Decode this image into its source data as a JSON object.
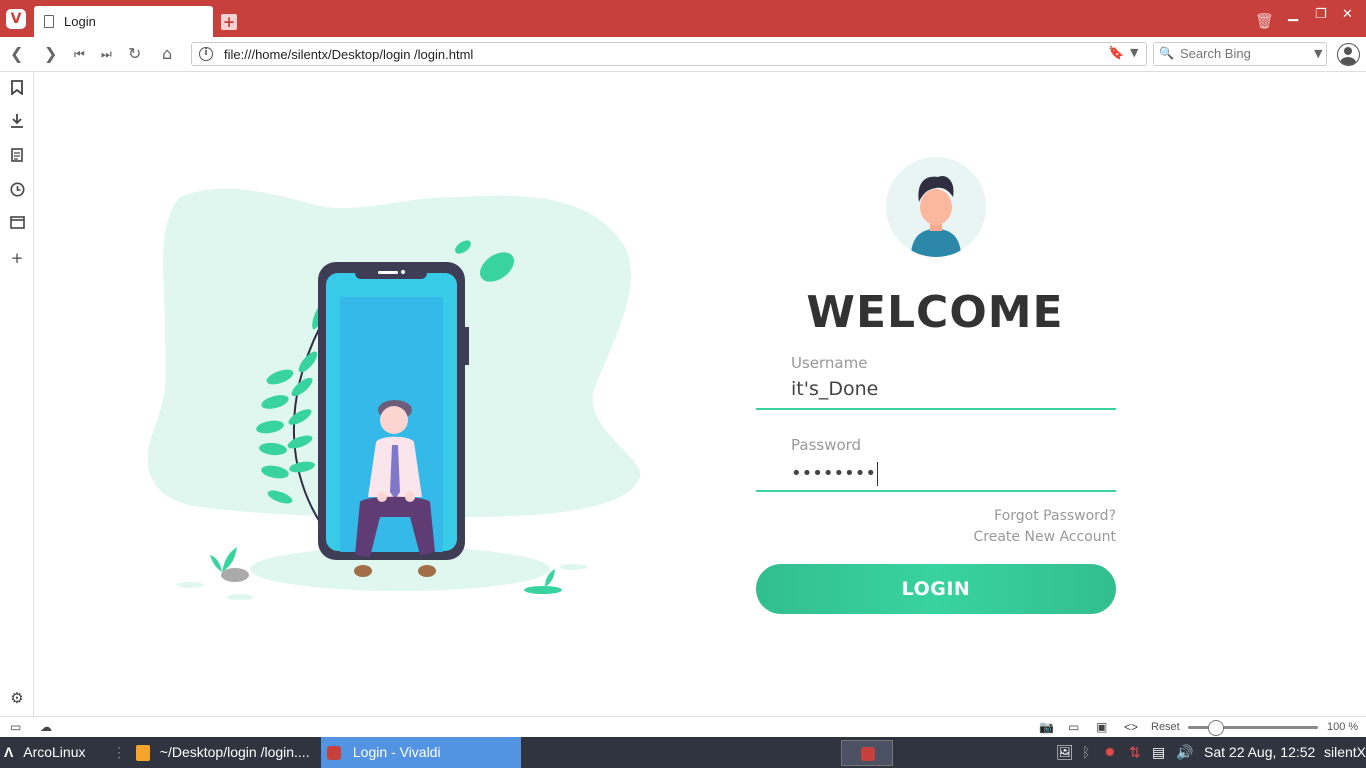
{
  "browser": {
    "tab_title": "Login",
    "url": "file:///home/silentx/Desktop/login /login.html",
    "search_placeholder": "Search Bing",
    "zoom_reset": "Reset",
    "zoom_level": "100 %",
    "brand_color": "#c8403c"
  },
  "page": {
    "welcome": "WELCOME",
    "username_label": "Username",
    "username_value": "it's_Done",
    "password_label": "Password",
    "password_value": "••••••••",
    "forgot_link": "Forgot Password?",
    "create_link": "Create New Account",
    "login_button": "LOGIN",
    "accent_color": "#38d39f"
  },
  "taskbar": {
    "start_label": "ArcoLinux",
    "window_1": "~/Desktop/login /login....",
    "window_2": "Login - Vivaldi",
    "clock": "Sat 22 Aug, 12:52",
    "user": "silentX"
  }
}
